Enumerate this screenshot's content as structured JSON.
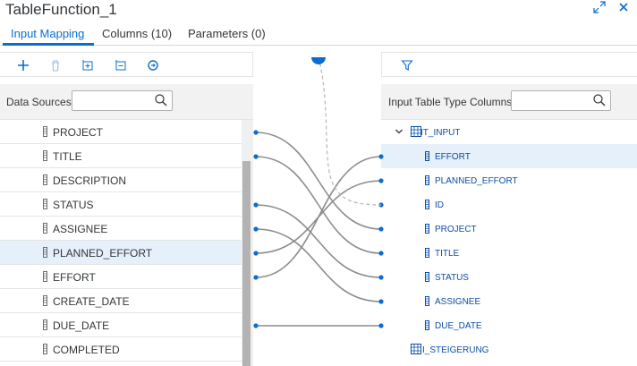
{
  "window": {
    "title": "TableFunction_1",
    "icons": {
      "expand": "expand-icon",
      "close": "close-icon"
    }
  },
  "tabs": [
    {
      "label": "Input Mapping",
      "active": true
    },
    {
      "label": "Columns (10)",
      "active": false
    },
    {
      "label": "Parameters (0)",
      "active": false
    }
  ],
  "toolbar": {
    "icons": [
      "add-icon",
      "delete-icon",
      "add-column-icon",
      "remove-column-icon",
      "refresh-icon"
    ],
    "filter_icon": "filter-icon"
  },
  "data_sources": {
    "label": "Data Sources",
    "search_value": "",
    "rows": [
      {
        "label": "PROJECT",
        "selected": false
      },
      {
        "label": "TITLE",
        "selected": false
      },
      {
        "label": "DESCRIPTION",
        "selected": false
      },
      {
        "label": "STATUS",
        "selected": false
      },
      {
        "label": "ASSIGNEE",
        "selected": false
      },
      {
        "label": "PLANNED_EFFORT",
        "selected": true
      },
      {
        "label": "EFFORT",
        "selected": false
      },
      {
        "label": "CREATE_DATE",
        "selected": false
      },
      {
        "label": "DUE_DATE",
        "selected": false
      },
      {
        "label": "COMPLETED",
        "selected": false
      }
    ]
  },
  "input_table": {
    "label": "Input Table Type Columns",
    "search_value": "",
    "group": {
      "label": "IT_INPUT",
      "expanded": true
    },
    "rows": [
      {
        "label": "EFFORT",
        "selected": true
      },
      {
        "label": "PLANNED_EFFORT",
        "selected": false
      },
      {
        "label": "ID",
        "selected": false
      },
      {
        "label": "PROJECT",
        "selected": false
      },
      {
        "label": "TITLE",
        "selected": false
      },
      {
        "label": "STATUS",
        "selected": false
      },
      {
        "label": "ASSIGNEE",
        "selected": false
      },
      {
        "label": "DUE_DATE",
        "selected": false
      }
    ],
    "second_group": {
      "label": "I_STEIGERUNG"
    }
  },
  "mappings": [
    {
      "from": "PROJECT",
      "to": "PROJECT"
    },
    {
      "from": "TITLE",
      "to": "TITLE"
    },
    {
      "from": "STATUS",
      "to": "STATUS"
    },
    {
      "from": "ASSIGNEE",
      "to": "ASSIGNEE"
    },
    {
      "from": "PLANNED_EFFORT",
      "to": "PLANNED_EFFORT"
    },
    {
      "from": "EFFORT",
      "to": "EFFORT"
    },
    {
      "from": "DUE_DATE",
      "to": "DUE_DATE"
    }
  ],
  "colors": {
    "accent": "#0a6ed1",
    "selected_row": "#e5f0fa",
    "wire": "#8c8c8c"
  }
}
